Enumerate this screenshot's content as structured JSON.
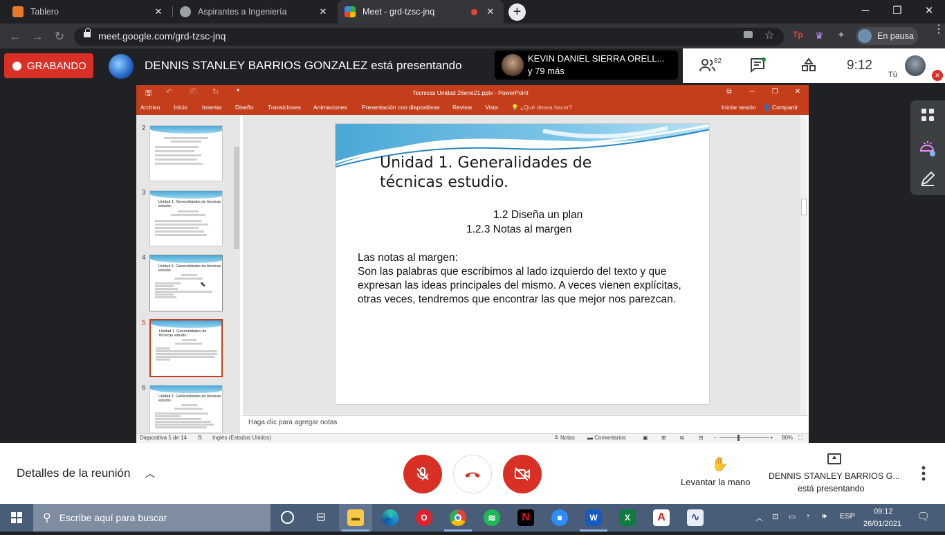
{
  "browser": {
    "tabs": [
      {
        "title": "Tablero",
        "favicon_color": "#e8782c"
      },
      {
        "title": "Aspirantes a Ingeniería",
        "favicon_color": "#9aa0a6"
      },
      {
        "title": "Meet - grd-tzsc-jnq",
        "favicon_color": "#34a853"
      }
    ],
    "url": "meet.google.com/grd-tzsc-jnq",
    "profile_label": "En pausa"
  },
  "meet": {
    "recording_label": "GRABANDO",
    "presenting_banner": "DENNIS STANLEY BARRIOS GONZALEZ está presentando",
    "participant_name": "KEVIN DANIEL SIERRA ORELL...",
    "participant_more": "y 79 más",
    "participant_count": "82",
    "time": "9:12",
    "self_label": "Tú",
    "meeting_details": "Detalles de la reunión",
    "raise_hand": "Levantar la mano",
    "presenter_name": "DENNIS STANLEY BARRIOS G...",
    "presenter_status": "está presentando"
  },
  "powerpoint": {
    "window_title": "Tecnicas Unidad 26ene21.pptx - PowerPoint",
    "ribbon_tabs": [
      "Archivo",
      "Inicio",
      "Insertar",
      "Diseño",
      "Transiciones",
      "Animaciones",
      "Presentación con diapositivas",
      "Revisar",
      "Vista"
    ],
    "tell_me": "¿Qué desea hacer?",
    "sign_in": "Iniciar sesión",
    "share": "Compartir",
    "slide_numbers": [
      "2",
      "3",
      "4",
      "5",
      "6"
    ],
    "thumb_titles": [
      "Unidad 1. Generalidades de técnicas estudio.",
      "Unidad 1. Generalidades de técnicas estudio.",
      "Unidad 1. Generalidades de técnicas estudio.",
      "Unidad 1. Generalidades de técnicas estudio."
    ],
    "slide": {
      "title": "Unidad 1. Generalidades de técnicas estudio.",
      "subtitle1": "1.2 Diseña un plan",
      "subtitle2": "1.2.3 Notas al margen",
      "body_heading": "Las notas al margen:",
      "body_text": "Son las palabras que escribimos al lado izquierdo del texto y que expresan las ideas principales del mismo. A veces vienen explícitas, otras veces, tendremos que encontrar las que mejor nos parezcan."
    },
    "notes_placeholder": "Haga clic para agregar notas",
    "status": {
      "slide_counter": "Diapositiva 5 de 14",
      "language": "Inglés (Estados Unidos)",
      "notes": "Notas",
      "comments": "Comentarios",
      "zoom": "80%"
    }
  },
  "taskbar": {
    "search_placeholder": "Escribe aquí para buscar",
    "language": "ESP",
    "time": "09:12",
    "date": "26/01/2021"
  },
  "colors": {
    "accent_ppt": "#c43e1c",
    "meet_red": "#d93025",
    "chrome_dark": "#202124"
  }
}
